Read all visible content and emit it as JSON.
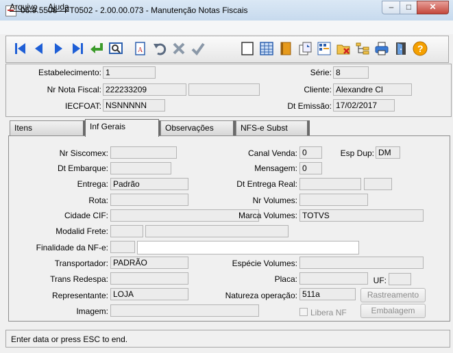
{
  "window": {
    "title": "06.9.5508 - FT0502 - 2.00.00.073 - Manutenção Notas Fiscais"
  },
  "menu": {
    "items": [
      "Arquivo",
      "Ajuda"
    ]
  },
  "toolbar": {
    "icons": [
      "first-icon",
      "previous-icon",
      "next-icon",
      "last-icon",
      "goto-icon",
      "zoom-icon",
      "print-preview-icon",
      "undo-icon",
      "cancel-icon",
      "confirm-icon",
      "new-icon",
      "table-icon",
      "notebook-icon",
      "copy-icon",
      "grid-icon",
      "delete-folder-icon",
      "tree-icon",
      "print-icon",
      "exit-icon",
      "help-icon"
    ]
  },
  "header": {
    "estabelecimento_label": "Estabelecimento:",
    "estabelecimento": "1",
    "serie_label": "Série:",
    "serie": "8",
    "nr_nota_label": "Nr Nota Fiscal:",
    "nr_nota": "222233209",
    "nr_nota_extra": "",
    "cliente_label": "Cliente:",
    "cliente": "Alexandre Cl",
    "iecfoat_label": "IECFOAT:",
    "iecfoat": "NSNNNNN",
    "dt_emissao_label": "Dt Emissão:",
    "dt_emissao": "17/02/2017"
  },
  "tabs": [
    "Itens",
    "Inf Gerais",
    "Observações",
    "NFS-e Subst"
  ],
  "form": {
    "nr_siscomex_label": "Nr Siscomex:",
    "nr_siscomex": "",
    "canal_venda_label": "Canal Venda:",
    "canal_venda": "0",
    "esp_dup_label": "Esp Dup:",
    "esp_dup": "DM",
    "dt_embarque_label": "Dt Embarque:",
    "dt_embarque": "",
    "mensagem_label": "Mensagem:",
    "mensagem": "0",
    "entrega_label": "Entrega:",
    "entrega": "Padrão",
    "dt_entrega_real_label": "Dt Entrega Real:",
    "dt_entrega_real": "",
    "rota_label": "Rota:",
    "rota": "",
    "nr_volumes_label": "Nr Volumes:",
    "nr_volumes": "",
    "cidade_cif_label": "Cidade CIF:",
    "cidade_cif": "",
    "marca_volumes_label": "Marca Volumes:",
    "marca_volumes": "TOTVS",
    "modalid_frete_label": "Modalid Frete:",
    "modalid_frete": "",
    "finalidade_label": "Finalidade da NF-e:",
    "finalidade": "",
    "transportador_label": "Transportador:",
    "transportador": "PADRÃO",
    "especie_volumes_label": "Espécie Volumes:",
    "especie_volumes": "",
    "trans_redespa_label": "Trans Redespa:",
    "trans_redespa": "",
    "placa_label": "Placa:",
    "placa": "",
    "uf_label": "UF:",
    "uf": "",
    "representante_label": "Representante:",
    "representante": "LOJA",
    "natureza_label": "Natureza operação:",
    "natureza": "511a",
    "rastreamento_label": "Rastreamento",
    "imagem_label": "Imagem:",
    "imagem": "",
    "libera_nf_label": "Libera NF",
    "embalagem_label": "Embalagem"
  },
  "status": {
    "text": "Enter data or press ESC to end."
  }
}
